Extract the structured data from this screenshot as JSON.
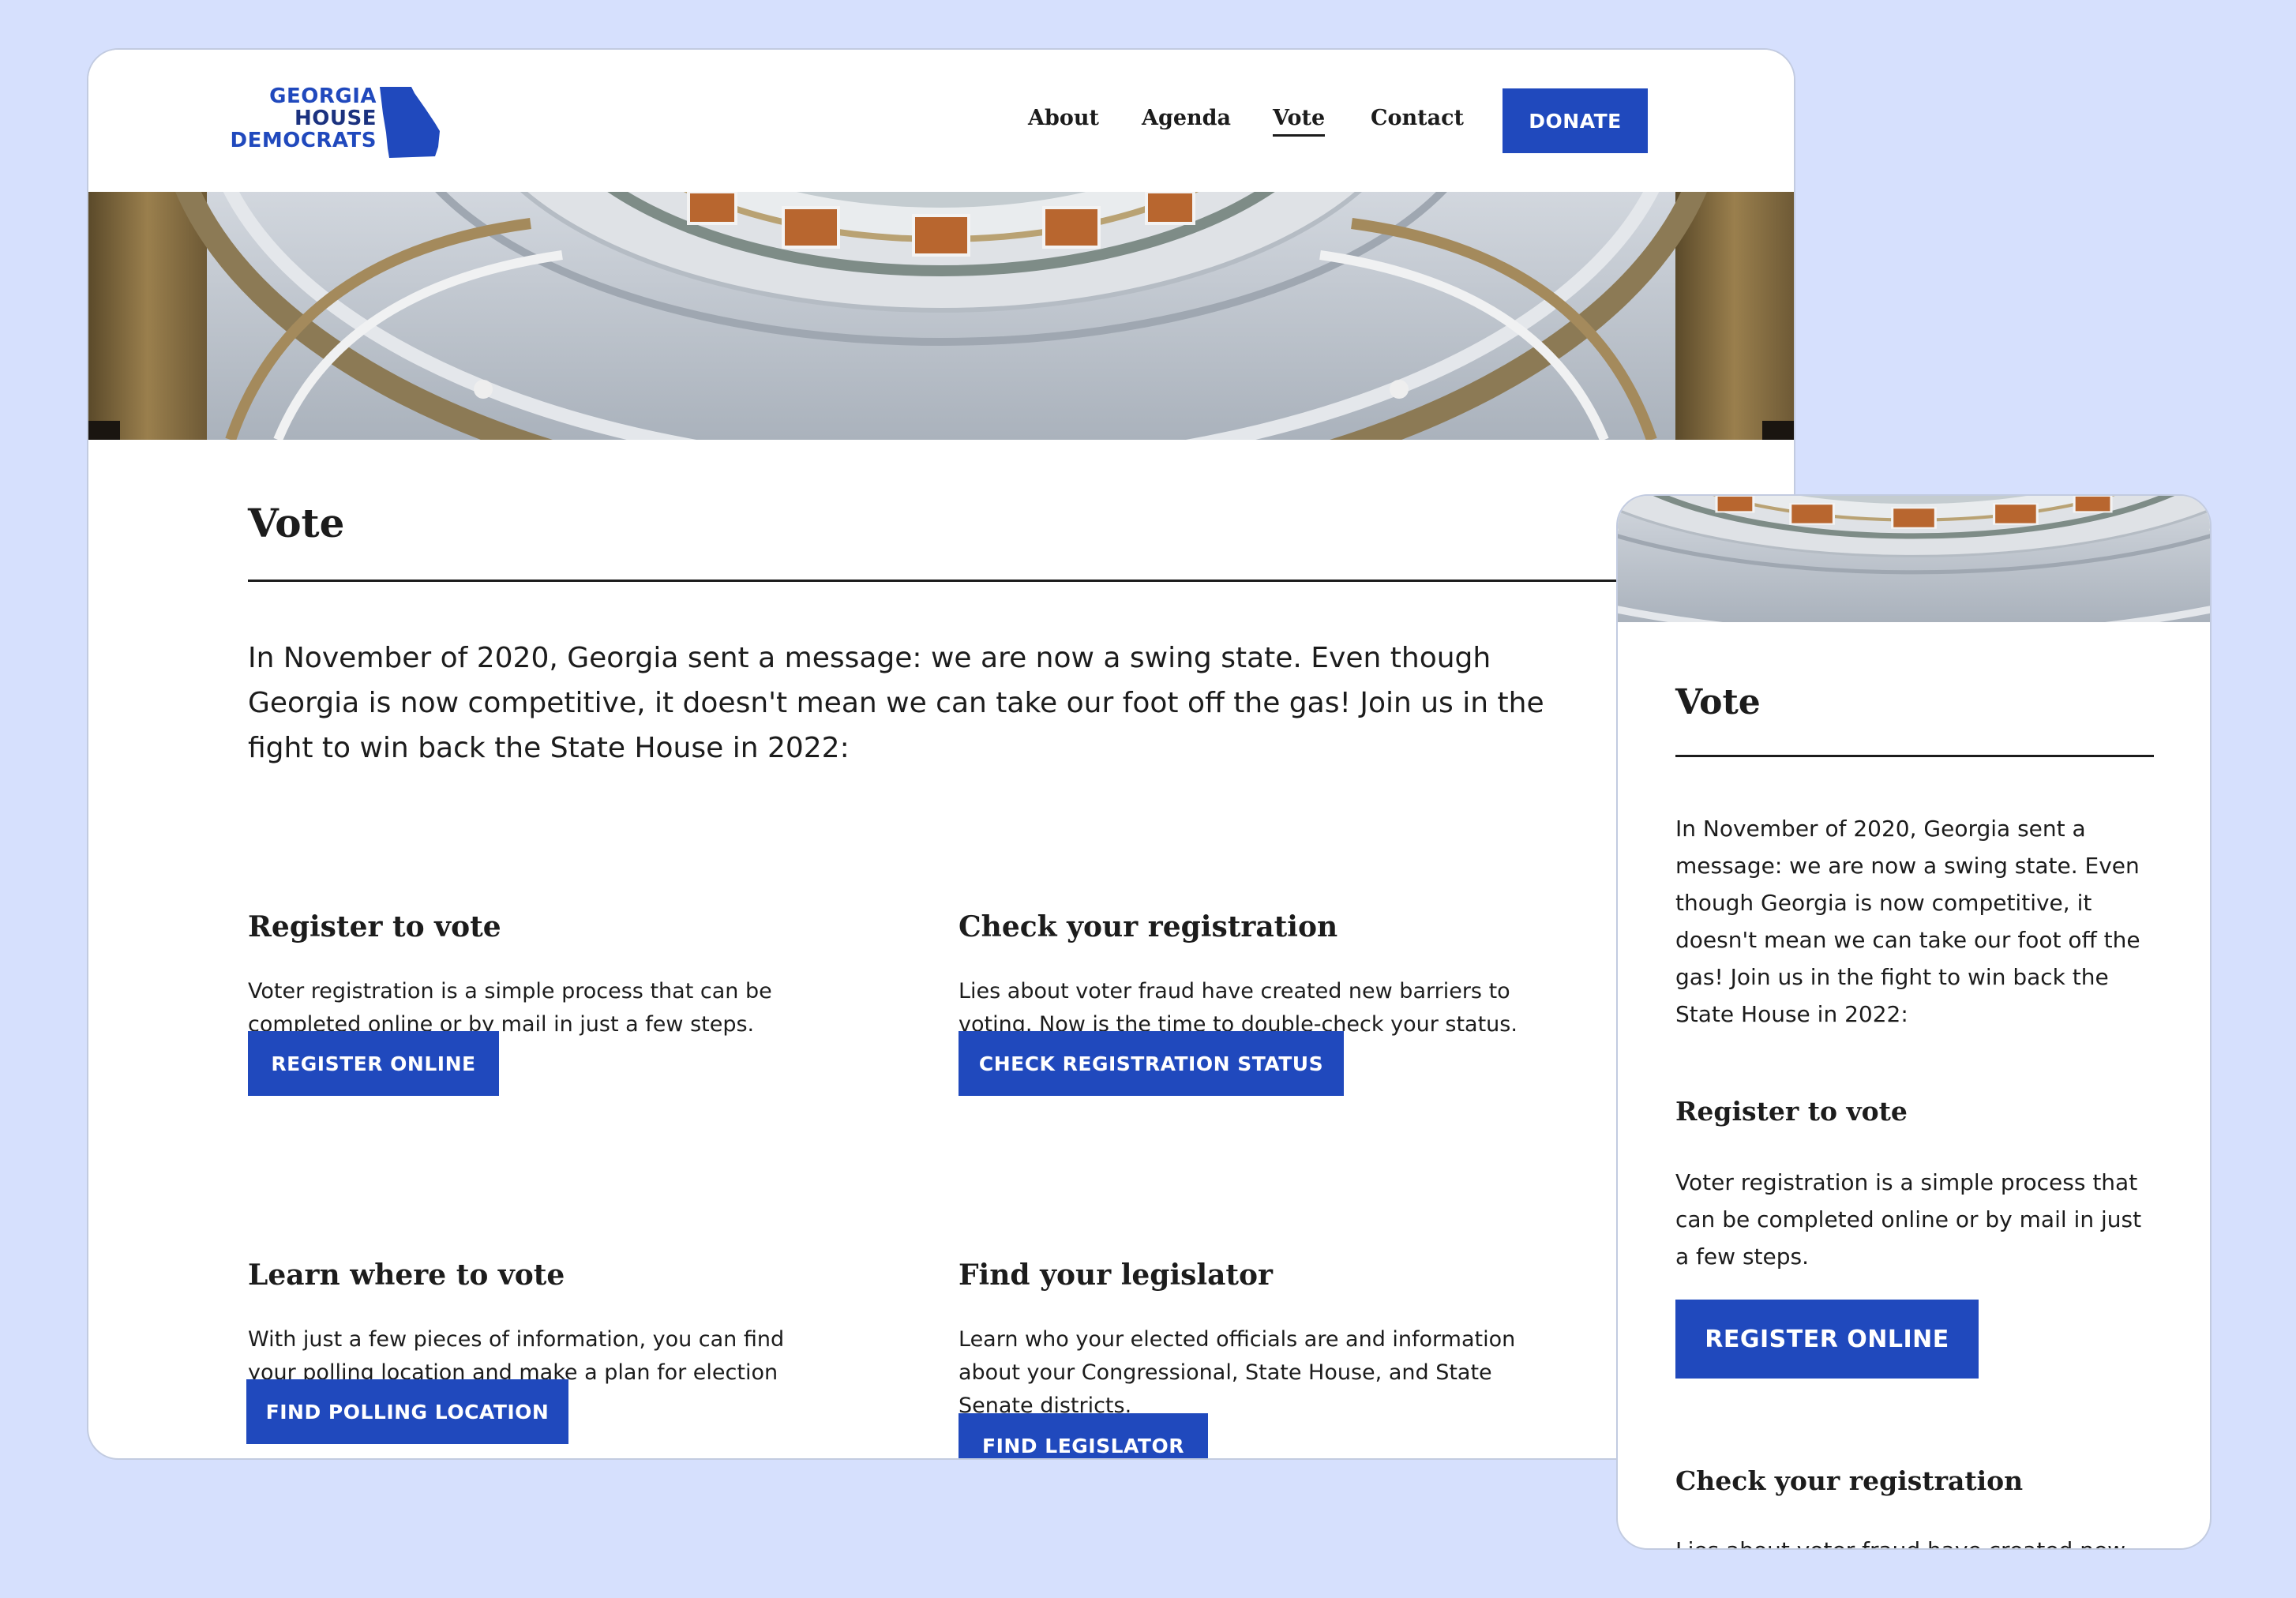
{
  "logo": {
    "lines": [
      "GEORGIA",
      "HOUSE",
      "DEMOCRATS"
    ],
    "icon": "georgia-state-icon"
  },
  "nav": {
    "items": [
      "About",
      "Agenda",
      "Vote",
      "Contact"
    ],
    "active": "Vote",
    "donate_label": "DONATE"
  },
  "colors": {
    "brand_blue": "#2049bd",
    "background": "#d6e0fd",
    "text": "#1c1c1c"
  },
  "page": {
    "title": "Vote",
    "intro": "In November of 2020, Georgia sent a message: we are now a swing state. Even though Georgia is now competitive, it doesn't mean we can take our foot off the gas! Join us in the fight to win back the State House in 2022:",
    "sections": [
      {
        "heading": "Register to vote",
        "body": "Voter registration is a simple process that can be completed online or by mail in just a few steps.",
        "button": "REGISTER ONLINE"
      },
      {
        "heading": "Check your registration",
        "body": "Lies about voter fraud have created new barriers to voting. Now is the time to double-check your status.",
        "button": "CHECK REGISTRATION STATUS"
      },
      {
        "heading": "Learn where to vote",
        "body": "With just a few pieces of information, you can find your polling location and make a plan for election day.",
        "button": "FIND POLLING LOCATION"
      },
      {
        "heading": "Find your legislator",
        "body": "Learn who your elected officials are and information about your Congressional, State House, and State Senate districts.",
        "button": "FIND LEGISLATOR"
      }
    ]
  },
  "mobile": {
    "partial_text": "Lies about voter fraud have created new"
  }
}
